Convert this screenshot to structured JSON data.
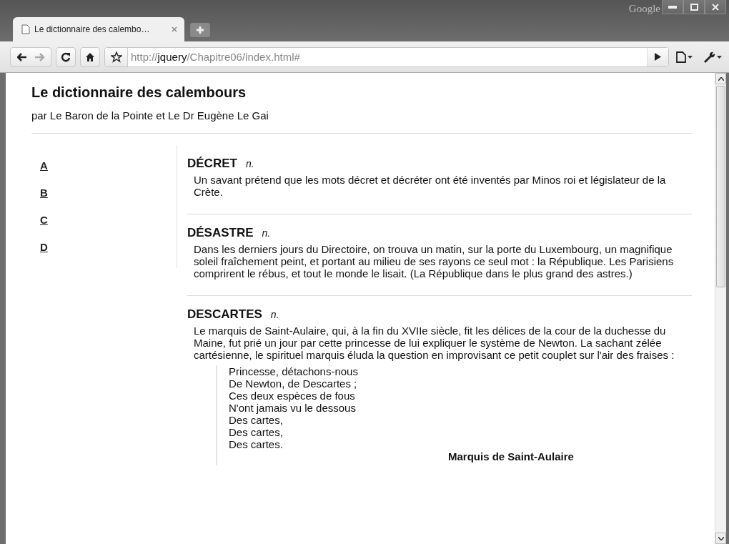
{
  "window": {
    "brand": "Google"
  },
  "tabs": [
    {
      "title": "Le dictionnaire des calembo…",
      "selected": true
    }
  ],
  "address": {
    "scheme": "http://",
    "host": "jquery",
    "path": "/Chapitre06/index.html#"
  },
  "page": {
    "title": "Le dictionnaire des calembours",
    "byline": "par Le Baron de la Pointe et Le Dr Eugène Le Gai"
  },
  "letters": [
    "A",
    "B",
    "C",
    "D"
  ],
  "entries": [
    {
      "term": "DÉCRET",
      "pos": "n.",
      "definition": "Un savant prétend que les mots décret et décréter ont été inventés par Minos roi et législateur de la Crète."
    },
    {
      "term": "DÉSASTRE",
      "pos": "n.",
      "definition": "Dans les derniers jours du Directoire, on trouva un matin, sur la porte du Luxembourg, un magnifique soleil fraîchement peint, et portant au milieu de ses rayons ce seul mot : la République. Les Parisiens comprirent le rébus, et tout le monde le lisait. (La République dans le plus grand des astres.)"
    },
    {
      "term": "DESCARTES",
      "pos": "n.",
      "definition": "Le marquis de Saint-Aulaire, qui, à la fin du XVIIe siècle, fit les délices de la cour de la duchesse du Maine, fut prié un jour par cette princesse de lui expliquer le système de Newton. La sachant zélée cartésienne, le spirituel marquis éluda la question en improvisant ce petit couplet sur l'air des fraises :",
      "quote": {
        "lines": [
          "Princesse, détachons-nous",
          "De Newton, de Descartes ;",
          "Ces deux espèces de fous",
          "N'ont jamais vu le dessous",
          "Des cartes,",
          "Des cartes,",
          "Des cartes."
        ],
        "author": "Marquis de Saint-Aulaire"
      }
    }
  ]
}
